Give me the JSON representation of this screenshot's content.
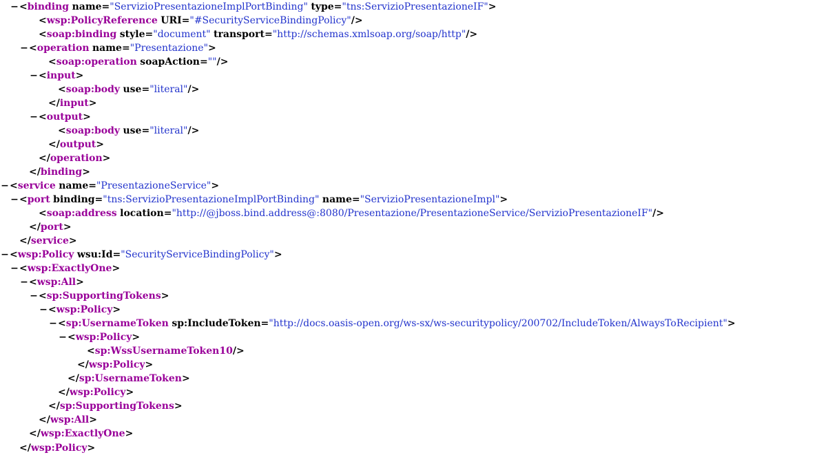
{
  "lines": [
    {
      "indent": 1,
      "toggle": true,
      "parts": [
        {
          "t": "pn",
          "v": "<"
        },
        {
          "t": "el",
          "v": "binding"
        },
        {
          "t": "sp",
          "v": " "
        },
        {
          "t": "at",
          "v": "name"
        },
        {
          "t": "pn",
          "v": "="
        },
        {
          "t": "av",
          "v": "\"ServizioPresentazioneImplPortBinding\""
        },
        {
          "t": "sp",
          "v": " "
        },
        {
          "t": "at",
          "v": "type"
        },
        {
          "t": "pn",
          "v": "="
        },
        {
          "t": "av",
          "v": "\"tns:ServizioPresentazioneIF\""
        },
        {
          "t": "pn",
          "v": ">"
        }
      ]
    },
    {
      "indent": 3,
      "toggle": false,
      "parts": [
        {
          "t": "pn",
          "v": "<"
        },
        {
          "t": "el",
          "v": "wsp:PolicyReference"
        },
        {
          "t": "sp",
          "v": " "
        },
        {
          "t": "at",
          "v": "URI"
        },
        {
          "t": "pn",
          "v": "="
        },
        {
          "t": "av",
          "v": "\"#SecurityServiceBindingPolicy\""
        },
        {
          "t": "pn",
          "v": "/>"
        }
      ]
    },
    {
      "indent": 3,
      "toggle": false,
      "parts": [
        {
          "t": "pn",
          "v": "<"
        },
        {
          "t": "el",
          "v": "soap:binding"
        },
        {
          "t": "sp",
          "v": " "
        },
        {
          "t": "at",
          "v": "style"
        },
        {
          "t": "pn",
          "v": "="
        },
        {
          "t": "av",
          "v": "\"document\""
        },
        {
          "t": "sp",
          "v": " "
        },
        {
          "t": "at",
          "v": "transport"
        },
        {
          "t": "pn",
          "v": "="
        },
        {
          "t": "av",
          "v": "\"http://schemas.xmlsoap.org/soap/http\""
        },
        {
          "t": "pn",
          "v": "/>"
        }
      ]
    },
    {
      "indent": 2,
      "toggle": true,
      "parts": [
        {
          "t": "pn",
          "v": "<"
        },
        {
          "t": "el",
          "v": "operation"
        },
        {
          "t": "sp",
          "v": " "
        },
        {
          "t": "at",
          "v": "name"
        },
        {
          "t": "pn",
          "v": "="
        },
        {
          "t": "av",
          "v": "\"Presentazione\""
        },
        {
          "t": "pn",
          "v": ">"
        }
      ]
    },
    {
      "indent": 4,
      "toggle": false,
      "parts": [
        {
          "t": "pn",
          "v": "<"
        },
        {
          "t": "el",
          "v": "soap:operation"
        },
        {
          "t": "sp",
          "v": " "
        },
        {
          "t": "at",
          "v": "soapAction"
        },
        {
          "t": "pn",
          "v": "="
        },
        {
          "t": "av",
          "v": "\"\""
        },
        {
          "t": "pn",
          "v": "/>"
        }
      ]
    },
    {
      "indent": 3,
      "toggle": true,
      "parts": [
        {
          "t": "pn",
          "v": "<"
        },
        {
          "t": "el",
          "v": "input"
        },
        {
          "t": "pn",
          "v": ">"
        }
      ]
    },
    {
      "indent": 5,
      "toggle": false,
      "parts": [
        {
          "t": "pn",
          "v": "<"
        },
        {
          "t": "el",
          "v": "soap:body"
        },
        {
          "t": "sp",
          "v": " "
        },
        {
          "t": "at",
          "v": "use"
        },
        {
          "t": "pn",
          "v": "="
        },
        {
          "t": "av",
          "v": "\"literal\""
        },
        {
          "t": "pn",
          "v": "/>"
        }
      ]
    },
    {
      "indent": 4,
      "toggle": false,
      "parts": [
        {
          "t": "pn",
          "v": "</"
        },
        {
          "t": "el",
          "v": "input"
        },
        {
          "t": "pn",
          "v": ">"
        }
      ]
    },
    {
      "indent": 3,
      "toggle": true,
      "parts": [
        {
          "t": "pn",
          "v": "<"
        },
        {
          "t": "el",
          "v": "output"
        },
        {
          "t": "pn",
          "v": ">"
        }
      ]
    },
    {
      "indent": 5,
      "toggle": false,
      "parts": [
        {
          "t": "pn",
          "v": "<"
        },
        {
          "t": "el",
          "v": "soap:body"
        },
        {
          "t": "sp",
          "v": " "
        },
        {
          "t": "at",
          "v": "use"
        },
        {
          "t": "pn",
          "v": "="
        },
        {
          "t": "av",
          "v": "\"literal\""
        },
        {
          "t": "pn",
          "v": "/>"
        }
      ]
    },
    {
      "indent": 4,
      "toggle": false,
      "parts": [
        {
          "t": "pn",
          "v": "</"
        },
        {
          "t": "el",
          "v": "output"
        },
        {
          "t": "pn",
          "v": ">"
        }
      ]
    },
    {
      "indent": 3,
      "toggle": false,
      "parts": [
        {
          "t": "pn",
          "v": "</"
        },
        {
          "t": "el",
          "v": "operation"
        },
        {
          "t": "pn",
          "v": ">"
        }
      ]
    },
    {
      "indent": 2,
      "toggle": false,
      "parts": [
        {
          "t": "pn",
          "v": "</"
        },
        {
          "t": "el",
          "v": "binding"
        },
        {
          "t": "pn",
          "v": ">"
        }
      ]
    },
    {
      "indent": 0,
      "toggle": true,
      "parts": [
        {
          "t": "pn",
          "v": "<"
        },
        {
          "t": "el",
          "v": "service"
        },
        {
          "t": "sp",
          "v": " "
        },
        {
          "t": "at",
          "v": "name"
        },
        {
          "t": "pn",
          "v": "="
        },
        {
          "t": "av",
          "v": "\"PresentazioneService\""
        },
        {
          "t": "pn",
          "v": ">"
        }
      ]
    },
    {
      "indent": 1,
      "toggle": true,
      "parts": [
        {
          "t": "pn",
          "v": "<"
        },
        {
          "t": "el",
          "v": "port"
        },
        {
          "t": "sp",
          "v": " "
        },
        {
          "t": "at",
          "v": "binding"
        },
        {
          "t": "pn",
          "v": "="
        },
        {
          "t": "av",
          "v": "\"tns:ServizioPresentazioneImplPortBinding\""
        },
        {
          "t": "sp",
          "v": " "
        },
        {
          "t": "at",
          "v": "name"
        },
        {
          "t": "pn",
          "v": "="
        },
        {
          "t": "av",
          "v": "\"ServizioPresentazioneImpl\""
        },
        {
          "t": "pn",
          "v": ">"
        }
      ]
    },
    {
      "indent": 3,
      "toggle": false,
      "parts": [
        {
          "t": "pn",
          "v": "<"
        },
        {
          "t": "el",
          "v": "soap:address"
        },
        {
          "t": "sp",
          "v": " "
        },
        {
          "t": "at",
          "v": "location"
        },
        {
          "t": "pn",
          "v": "="
        },
        {
          "t": "av",
          "v": "\"http://@jboss.bind.address@:8080/Presentazione/PresentazioneService/ServizioPresentazioneIF\""
        },
        {
          "t": "pn",
          "v": "/>"
        }
      ]
    },
    {
      "indent": 2,
      "toggle": false,
      "parts": [
        {
          "t": "pn",
          "v": "</"
        },
        {
          "t": "el",
          "v": "port"
        },
        {
          "t": "pn",
          "v": ">"
        }
      ]
    },
    {
      "indent": 1,
      "toggle": false,
      "parts": [
        {
          "t": "pn",
          "v": "</"
        },
        {
          "t": "el",
          "v": "service"
        },
        {
          "t": "pn",
          "v": ">"
        }
      ]
    },
    {
      "indent": 0,
      "toggle": true,
      "parts": [
        {
          "t": "pn",
          "v": "<"
        },
        {
          "t": "el",
          "v": "wsp:Policy"
        },
        {
          "t": "sp",
          "v": " "
        },
        {
          "t": "at",
          "v": "wsu:Id"
        },
        {
          "t": "pn",
          "v": "="
        },
        {
          "t": "av",
          "v": "\"SecurityServiceBindingPolicy\""
        },
        {
          "t": "pn",
          "v": ">"
        }
      ]
    },
    {
      "indent": 1,
      "toggle": true,
      "parts": [
        {
          "t": "pn",
          "v": "<"
        },
        {
          "t": "el",
          "v": "wsp:ExactlyOne"
        },
        {
          "t": "pn",
          "v": ">"
        }
      ]
    },
    {
      "indent": 2,
      "toggle": true,
      "parts": [
        {
          "t": "pn",
          "v": "<"
        },
        {
          "t": "el",
          "v": "wsp:All"
        },
        {
          "t": "pn",
          "v": ">"
        }
      ]
    },
    {
      "indent": 3,
      "toggle": true,
      "parts": [
        {
          "t": "pn",
          "v": "<"
        },
        {
          "t": "el",
          "v": "sp:SupportingTokens"
        },
        {
          "t": "pn",
          "v": ">"
        }
      ]
    },
    {
      "indent": 4,
      "toggle": true,
      "parts": [
        {
          "t": "pn",
          "v": "<"
        },
        {
          "t": "el",
          "v": "wsp:Policy"
        },
        {
          "t": "pn",
          "v": ">"
        }
      ]
    },
    {
      "indent": 5,
      "toggle": true,
      "parts": [
        {
          "t": "pn",
          "v": "<"
        },
        {
          "t": "el",
          "v": "sp:UsernameToken"
        },
        {
          "t": "sp",
          "v": " "
        },
        {
          "t": "at",
          "v": "sp:IncludeToken"
        },
        {
          "t": "pn",
          "v": "="
        },
        {
          "t": "av",
          "v": "\"http://docs.oasis-open.org/ws-sx/ws-securitypolicy/200702/IncludeToken/AlwaysToRecipient\""
        },
        {
          "t": "pn",
          "v": ">"
        }
      ]
    },
    {
      "indent": 6,
      "toggle": true,
      "parts": [
        {
          "t": "pn",
          "v": "<"
        },
        {
          "t": "el",
          "v": "wsp:Policy"
        },
        {
          "t": "pn",
          "v": ">"
        }
      ]
    },
    {
      "indent": 8,
      "toggle": false,
      "parts": [
        {
          "t": "pn",
          "v": "<"
        },
        {
          "t": "el",
          "v": "sp:WssUsernameToken10"
        },
        {
          "t": "pn",
          "v": "/>"
        }
      ]
    },
    {
      "indent": 7,
      "toggle": false,
      "parts": [
        {
          "t": "pn",
          "v": "</"
        },
        {
          "t": "el",
          "v": "wsp:Policy"
        },
        {
          "t": "pn",
          "v": ">"
        }
      ]
    },
    {
      "indent": 6,
      "toggle": false,
      "parts": [
        {
          "t": "pn",
          "v": "</"
        },
        {
          "t": "el",
          "v": "sp:UsernameToken"
        },
        {
          "t": "pn",
          "v": ">"
        }
      ]
    },
    {
      "indent": 5,
      "toggle": false,
      "parts": [
        {
          "t": "pn",
          "v": "</"
        },
        {
          "t": "el",
          "v": "wsp:Policy"
        },
        {
          "t": "pn",
          "v": ">"
        }
      ]
    },
    {
      "indent": 4,
      "toggle": false,
      "parts": [
        {
          "t": "pn",
          "v": "</"
        },
        {
          "t": "el",
          "v": "sp:SupportingTokens"
        },
        {
          "t": "pn",
          "v": ">"
        }
      ]
    },
    {
      "indent": 3,
      "toggle": false,
      "parts": [
        {
          "t": "pn",
          "v": "</"
        },
        {
          "t": "el",
          "v": "wsp:All"
        },
        {
          "t": "pn",
          "v": ">"
        }
      ]
    },
    {
      "indent": 2,
      "toggle": false,
      "parts": [
        {
          "t": "pn",
          "v": "</"
        },
        {
          "t": "el",
          "v": "wsp:ExactlyOne"
        },
        {
          "t": "pn",
          "v": ">"
        }
      ]
    },
    {
      "indent": 1,
      "toggle": false,
      "parts": [
        {
          "t": "pn",
          "v": "</"
        },
        {
          "t": "el",
          "v": "wsp:Policy"
        },
        {
          "t": "pn",
          "v": ">"
        }
      ]
    }
  ],
  "toggleSymbol": "−"
}
